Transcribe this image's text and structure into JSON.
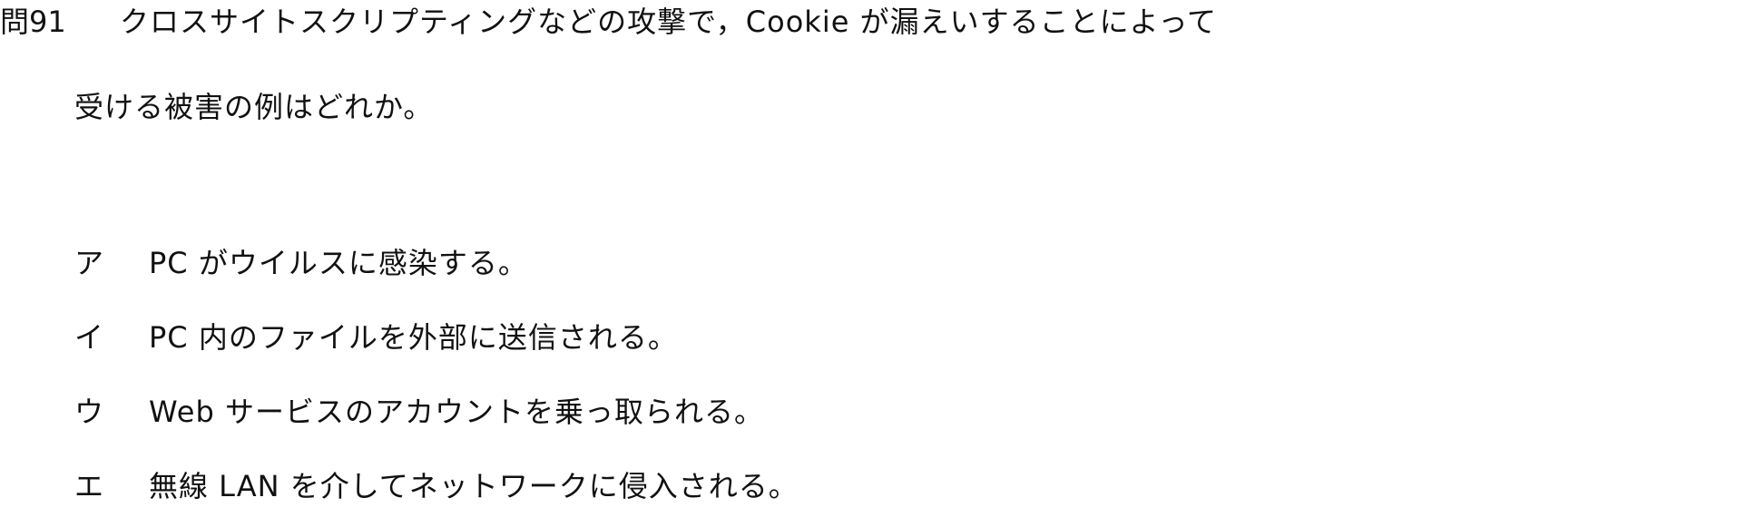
{
  "question": {
    "number": "問91",
    "stem_line_1": "クロスサイトスクリプティングなどの攻撃で，Cookie が漏えいすることによって",
    "stem_line_2": "受ける被害の例はどれか。"
  },
  "choices": [
    {
      "marker": "ア",
      "text": "PC がウイルスに感染する。"
    },
    {
      "marker": "イ",
      "text": "PC 内のファイルを外部に送信される。"
    },
    {
      "marker": "ウ",
      "text": "Web サービスのアカウントを乗っ取られる。"
    },
    {
      "marker": "エ",
      "text": "無線 LAN を介してネットワークに侵入される。"
    }
  ]
}
